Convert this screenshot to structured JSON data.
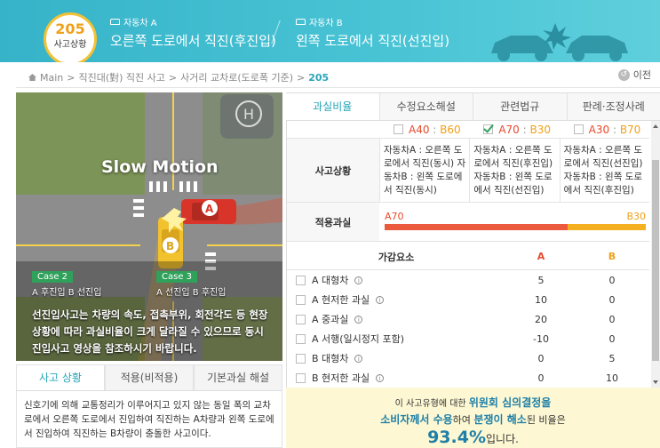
{
  "header": {
    "case_number": "205",
    "case_label": "사고상황",
    "vehicle_a": {
      "tag": "자동차 A",
      "title": "오른쪽 도로에서 직진(후진입)"
    },
    "vehicle_b": {
      "tag": "자동차 B",
      "title": "왼쪽 도로에서 직진(선진입)"
    },
    "bg_color": "#49c4d5"
  },
  "breadcrumb": {
    "items": [
      "Main",
      "직진대(對) 직진 사고",
      "사거리 교차로(도로폭 기준)"
    ],
    "current": "205",
    "sep": ">"
  },
  "prev_button": {
    "label": "이전"
  },
  "video": {
    "overlay_title": "Slow Motion",
    "cases": [
      {
        "badge": "Case 2",
        "text": "A 후진입 B 선진입"
      },
      {
        "badge": "Case 3",
        "text": "A 선진입 B 후진입"
      }
    ],
    "description": "선진입사고는 차량의 속도, 접촉부위, 회전각도 등 현장상황에 따라 과실비율이 크게 달라질 수 있으므로 동시진입사고 영상을 참조하시기 바랍니다.",
    "car_a_label": "A",
    "car_b_label": "B"
  },
  "left_tabs": {
    "items": [
      "사고 상황",
      "적용(비적용)",
      "기본과실 해설"
    ],
    "description": "신호기에 의해 교통정리가 이루어지고 있지 않는 동일 폭의 교차로에서 오른쪽 도로에서 진입하여 직진하는 A차량과 왼쪽 도로에서 진입하여 직진하는 B차량이 충돌한 사고이다."
  },
  "right_tabs": {
    "items": [
      "과실비율",
      "수정요소해설",
      "관련법규",
      "판례·조정사례"
    ]
  },
  "ratios": [
    {
      "a": "A40",
      "b": "B60",
      "checked": false
    },
    {
      "a": "A70",
      "b": "B30",
      "checked": true
    },
    {
      "a": "A30",
      "b": "B70",
      "checked": false
    }
  ],
  "situation": {
    "label": "사고상황",
    "cols": [
      "자동차A : 오른쪽 도로에서 직진(동시) 자동차B : 왼쪽 도로에서 직진(동시)",
      "자동차A : 오른쪽 도로에서 직진(후진입) 자동차B : 왼쪽 도로에서 직진(선진입)",
      "자동차A : 오른쪽 도로에서 직진(선진입) 자동차B : 왼쪽 도로에서 직진(후진입)"
    ]
  },
  "applied": {
    "label": "적용과실",
    "a_label": "A70",
    "b_label": "B30",
    "a_pct": 70,
    "b_pct": 30,
    "a_color": "#ec5a3d",
    "b_color": "#f4b021"
  },
  "adjust": {
    "header": {
      "name": "가감요소",
      "a": "A",
      "b": "B"
    },
    "rows": [
      {
        "name": "A 대형차",
        "info": true,
        "a": "5",
        "b": "0"
      },
      {
        "name": "A 현저한 과실",
        "info": true,
        "a": "10",
        "b": "0"
      },
      {
        "name": "A 중과실",
        "info": true,
        "a": "20",
        "b": "0"
      },
      {
        "name": "A 서행(일시정지 포함)",
        "info": false,
        "a": "-10",
        "b": "0"
      },
      {
        "name": "B 대형차",
        "info": true,
        "a": "0",
        "b": "5"
      },
      {
        "name": "B 현저한 과실",
        "info": true,
        "a": "0",
        "b": "10"
      }
    ]
  },
  "notice": {
    "line1_pre": "이 사고유형에 대한",
    "line1_em": "위원회 심의결정을",
    "line2_em1": "소비자께서 수용",
    "line2_mid": "하여",
    "line2_em2": "분쟁이 해소",
    "line2_post": "된 비율은",
    "percent": "93.4%",
    "percent_suffix": "입니다."
  }
}
